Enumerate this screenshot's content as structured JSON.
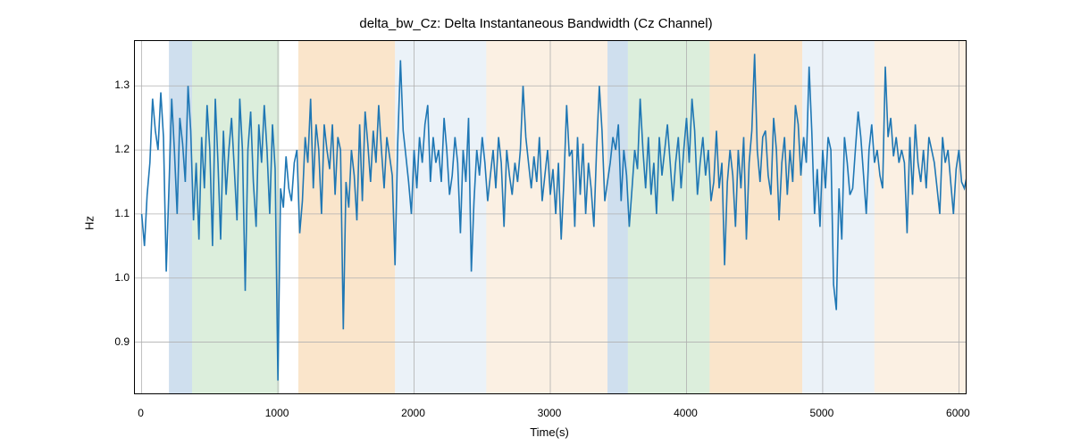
{
  "chart_data": {
    "type": "line",
    "title": "delta_bw_Cz: Delta Instantaneous Bandwidth (Cz Channel)",
    "xlabel": "Time(s)",
    "ylabel": "Hz",
    "xlim": [
      -50,
      6050
    ],
    "ylim": [
      0.82,
      1.37
    ],
    "xticks": [
      0,
      1000,
      2000,
      3000,
      4000,
      5000,
      6000
    ],
    "yticks": [
      0.9,
      1.0,
      1.1,
      1.2,
      1.3
    ],
    "bands": [
      {
        "x0": 200,
        "x1": 370,
        "color": "#a8c5e0"
      },
      {
        "x0": 370,
        "x1": 1010,
        "color": "#c0e0c0"
      },
      {
        "x0": 1150,
        "x1": 1860,
        "color": "#f5cfa0"
      },
      {
        "x0": 1860,
        "x1": 2530,
        "color": "#dbe7f2"
      },
      {
        "x0": 2530,
        "x1": 3420,
        "color": "#f8e4cc"
      },
      {
        "x0": 3420,
        "x1": 3570,
        "color": "#a8c5e0"
      },
      {
        "x0": 3570,
        "x1": 4170,
        "color": "#c0e0c0"
      },
      {
        "x0": 4170,
        "x1": 4850,
        "color": "#f5cfa0"
      },
      {
        "x0": 4850,
        "x1": 5380,
        "color": "#dbe7f2"
      },
      {
        "x0": 5380,
        "x1": 6050,
        "color": "#f8e4cc"
      }
    ],
    "series": [
      {
        "name": "delta_bw_Cz",
        "color": "#1f77b4",
        "x_step_approx": 20,
        "values": [
          1.1,
          1.05,
          1.13,
          1.18,
          1.28,
          1.23,
          1.2,
          1.29,
          1.22,
          1.01,
          1.14,
          1.28,
          1.2,
          1.1,
          1.25,
          1.21,
          1.15,
          1.3,
          1.23,
          1.09,
          1.18,
          1.06,
          1.22,
          1.14,
          1.27,
          1.2,
          1.05,
          1.28,
          1.18,
          1.06,
          1.23,
          1.13,
          1.2,
          1.25,
          1.17,
          1.09,
          1.28,
          1.2,
          0.98,
          1.2,
          1.26,
          1.15,
          1.08,
          1.24,
          1.18,
          1.27,
          1.2,
          1.1,
          1.24,
          1.17,
          0.84,
          1.14,
          1.11,
          1.19,
          1.14,
          1.12,
          1.18,
          1.2,
          1.07,
          1.12,
          1.22,
          1.18,
          1.28,
          1.14,
          1.24,
          1.2,
          1.1,
          1.24,
          1.2,
          1.17,
          1.24,
          1.13,
          1.22,
          1.2,
          0.92,
          1.15,
          1.11,
          1.2,
          1.16,
          1.09,
          1.24,
          1.12,
          1.26,
          1.21,
          1.15,
          1.23,
          1.18,
          1.27,
          1.2,
          1.14,
          1.22,
          1.19,
          1.16,
          1.02,
          1.21,
          1.34,
          1.23,
          1.19,
          1.15,
          1.1,
          1.2,
          1.14,
          1.22,
          1.18,
          1.24,
          1.27,
          1.15,
          1.22,
          1.18,
          1.2,
          1.15,
          1.25,
          1.2,
          1.13,
          1.16,
          1.22,
          1.18,
          1.07,
          1.2,
          1.15,
          1.25,
          1.01,
          1.12,
          1.2,
          1.16,
          1.22,
          1.18,
          1.12,
          1.16,
          1.2,
          1.14,
          1.22,
          1.18,
          1.08,
          1.2,
          1.16,
          1.13,
          1.18,
          1.15,
          1.2,
          1.3,
          1.22,
          1.18,
          1.14,
          1.19,
          1.15,
          1.22,
          1.12,
          1.16,
          1.2,
          1.13,
          1.17,
          1.1,
          1.18,
          1.06,
          1.15,
          1.27,
          1.19,
          1.2,
          1.08,
          1.22,
          1.13,
          1.21,
          1.1,
          1.18,
          1.14,
          1.08,
          1.2,
          1.3,
          1.23,
          1.12,
          1.15,
          1.18,
          1.22,
          1.2,
          1.24,
          1.12,
          1.2,
          1.16,
          1.08,
          1.14,
          1.2,
          1.17,
          1.28,
          1.2,
          1.14,
          1.22,
          1.13,
          1.18,
          1.1,
          1.22,
          1.16,
          1.2,
          1.24,
          1.18,
          1.12,
          1.18,
          1.22,
          1.14,
          1.2,
          1.25,
          1.18,
          1.28,
          1.23,
          1.13,
          1.18,
          1.22,
          1.16,
          1.2,
          1.12,
          1.15,
          1.23,
          1.14,
          1.18,
          1.02,
          1.15,
          1.2,
          1.16,
          1.08,
          1.2,
          1.14,
          1.22,
          1.06,
          1.18,
          1.23,
          1.35,
          1.2,
          1.15,
          1.22,
          1.23,
          1.16,
          1.13,
          1.25,
          1.2,
          1.09,
          1.18,
          1.22,
          1.13,
          1.2,
          1.15,
          1.27,
          1.24,
          1.16,
          1.22,
          1.18,
          1.33,
          1.23,
          1.1,
          1.17,
          1.08,
          1.2,
          1.14,
          1.22,
          1.2,
          0.99,
          0.95,
          1.14,
          1.06,
          1.22,
          1.18,
          1.13,
          1.14,
          1.2,
          1.26,
          1.22,
          1.16,
          1.1,
          1.2,
          1.24,
          1.18,
          1.2,
          1.16,
          1.14,
          1.33,
          1.22,
          1.25,
          1.19,
          1.22,
          1.18,
          1.2,
          1.18,
          1.07,
          1.22,
          1.13,
          1.24,
          1.18,
          1.15,
          1.2,
          1.14,
          1.22,
          1.2,
          1.18,
          1.14,
          1.1,
          1.22,
          1.18,
          1.2,
          1.15,
          1.1,
          1.17,
          1.2,
          1.15,
          1.14,
          1.16,
          1.12,
          1.1
        ]
      }
    ]
  }
}
